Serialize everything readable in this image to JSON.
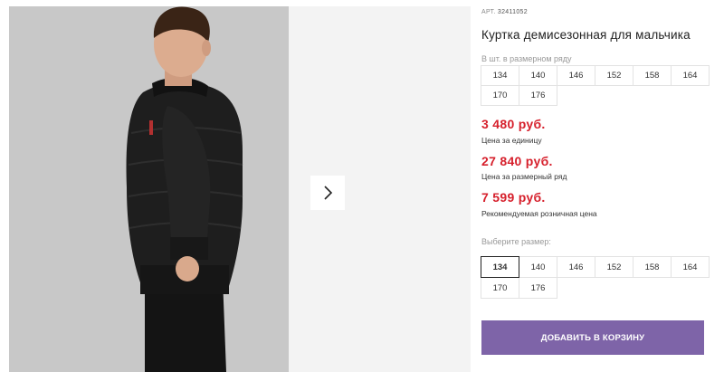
{
  "product": {
    "art_label": "АРТ.",
    "art_number": "32411052",
    "title": "Куртка демисезонная для мальчика"
  },
  "row_sizes": {
    "label": "В шт. в размерном ряду",
    "sizes": [
      "134",
      "140",
      "146",
      "152",
      "158",
      "164",
      "170",
      "176"
    ]
  },
  "prices": {
    "unit_price": "3 480 руб.",
    "unit_note": "Цена за единицу",
    "row_price": "27 840 руб.",
    "row_note": "Цена за размерный ряд",
    "retail_price": "7 599 руб.",
    "retail_note": "Рекомендуемая розничная цена"
  },
  "size_select": {
    "label": "Выберите размер:",
    "selected": "134",
    "sizes": [
      "134",
      "140",
      "146",
      "152",
      "158",
      "164",
      "170",
      "176"
    ]
  },
  "cart_button": "ДОБАВИТЬ В КОРЗИНУ",
  "colors": {
    "price": "#d6202c",
    "button": "#7e64a8",
    "photo_bg": "#c9c9c9"
  },
  "icons": {
    "next": "chevron-right-icon"
  }
}
